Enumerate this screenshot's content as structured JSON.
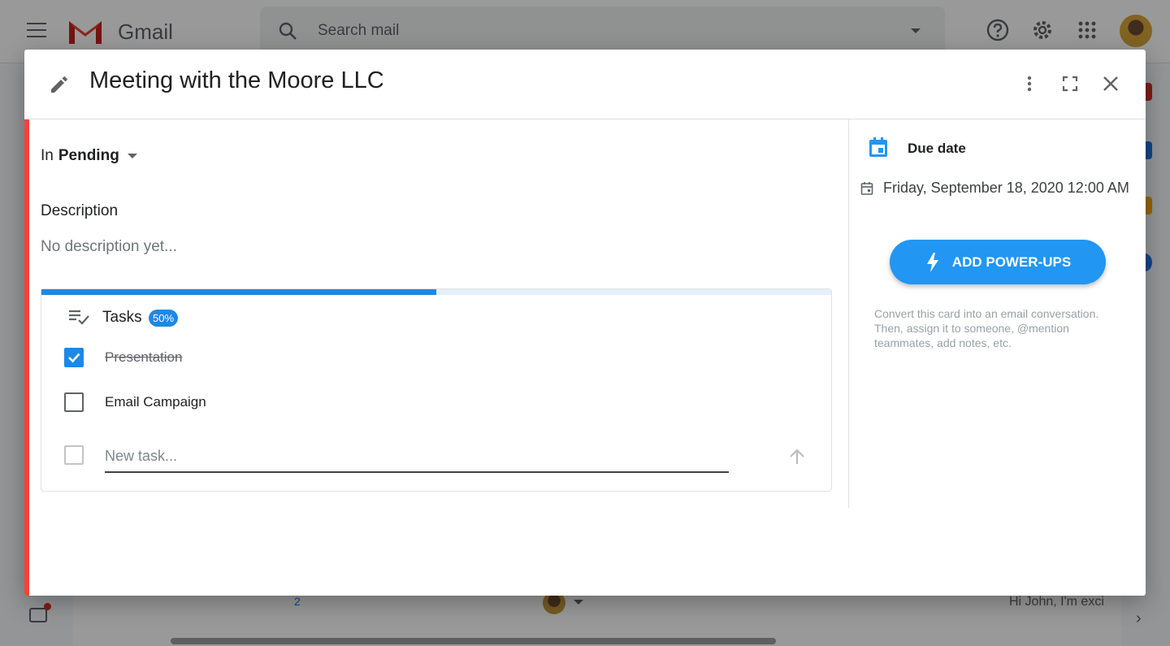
{
  "gmail": {
    "app_name": "Gmail",
    "search_placeholder": "Search mail",
    "background": {
      "chat_count": "2",
      "preview_text": "Hi John, I'm exci"
    }
  },
  "card": {
    "title": "Meeting with the Moore LLC",
    "status_prefix": "In",
    "status": "Pending",
    "description_label": "Description",
    "description_placeholder": "No description yet...",
    "tasks": {
      "label": "Tasks",
      "progress_badge": "50%",
      "progress_fraction": 0.5,
      "items": [
        {
          "text": "Presentation",
          "done": true
        },
        {
          "text": "Email Campaign",
          "done": false
        }
      ],
      "new_task_placeholder": "New task..."
    },
    "sidebar": {
      "due_label": "Due date",
      "due_value": "Friday, September 18, 2020 12:00 AM",
      "powerups_button": "ADD POWER-UPS",
      "powerups_description": "Convert this card into an email conversation. Then, assign it to someone, @mention teammates, add notes, etc."
    }
  },
  "colors": {
    "accent_red": "#f44336",
    "primary_blue": "#1e88e5",
    "button_blue": "#2196f3"
  },
  "icons": [
    "menu-icon",
    "gmail-logo-icon",
    "search-icon",
    "help-icon",
    "gear-icon",
    "apps-icon",
    "pencil-icon",
    "more-vert-icon",
    "fullscreen-icon",
    "close-icon",
    "tasks-icon",
    "checkbox-icon",
    "send-arrow-icon",
    "calendar-icon",
    "bolt-icon"
  ]
}
